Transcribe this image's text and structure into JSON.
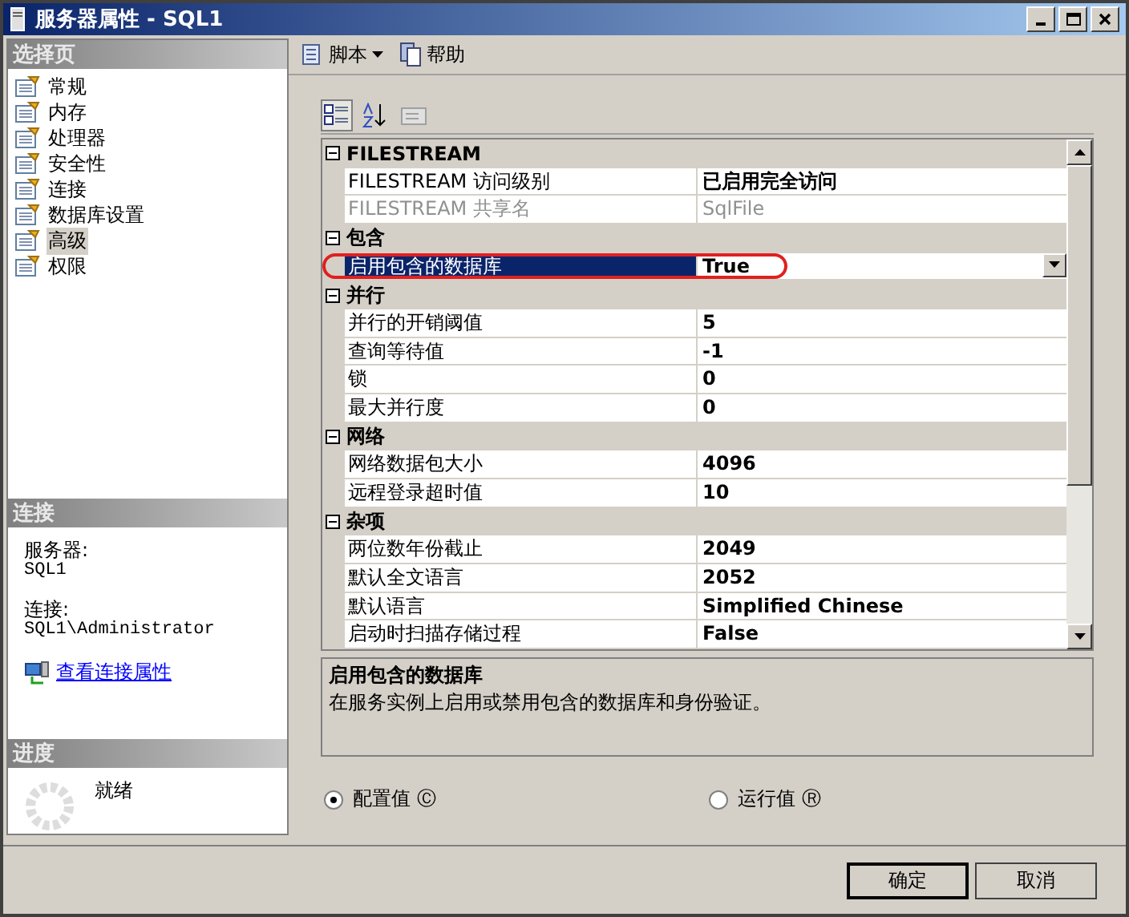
{
  "window": {
    "title": "服务器属性 - SQL1"
  },
  "select_page": {
    "header": "选择页",
    "items": [
      {
        "label": "常规",
        "selected": false
      },
      {
        "label": "内存",
        "selected": false
      },
      {
        "label": "处理器",
        "selected": false
      },
      {
        "label": "安全性",
        "selected": false
      },
      {
        "label": "连接",
        "selected": false
      },
      {
        "label": "数据库设置",
        "selected": false
      },
      {
        "label": "高级",
        "selected": true
      },
      {
        "label": "权限",
        "selected": false
      }
    ]
  },
  "connection": {
    "header": "连接",
    "server_label": "服务器:",
    "server": "SQL1",
    "connection_label": "连接:",
    "connection": "SQL1\\Administrator",
    "link": "查看连接属性"
  },
  "progress": {
    "header": "进度",
    "status": "就绪"
  },
  "toolbar": {
    "script": "脚本",
    "help": "帮助"
  },
  "properties": [
    {
      "category": "FILESTREAM",
      "expanded": true,
      "rows": [
        {
          "name": "FILESTREAM 访问级别",
          "value": "已启用完全访问",
          "disabled": false,
          "selected": false
        },
        {
          "name": "FILESTREAM 共享名",
          "value": "SqlFile",
          "disabled": true,
          "selected": false
        }
      ]
    },
    {
      "category": "包含",
      "expanded": true,
      "rows": [
        {
          "name": "启用包含的数据库",
          "value": "True",
          "disabled": false,
          "selected": true
        }
      ]
    },
    {
      "category": "并行",
      "expanded": true,
      "rows": [
        {
          "name": "并行的开销阈值",
          "value": "5",
          "disabled": false,
          "selected": false
        },
        {
          "name": "查询等待值",
          "value": "-1",
          "disabled": false,
          "selected": false
        },
        {
          "name": "锁",
          "value": "0",
          "disabled": false,
          "selected": false
        },
        {
          "name": "最大并行度",
          "value": "0",
          "disabled": false,
          "selected": false
        }
      ]
    },
    {
      "category": "网络",
      "expanded": true,
      "rows": [
        {
          "name": "网络数据包大小",
          "value": "4096",
          "disabled": false,
          "selected": false
        },
        {
          "name": "远程登录超时值",
          "value": "10",
          "disabled": false,
          "selected": false
        }
      ]
    },
    {
      "category": "杂项",
      "expanded": true,
      "rows": [
        {
          "name": "两位数年份截止",
          "value": "2049",
          "disabled": false,
          "selected": false
        },
        {
          "name": "默认全文语言",
          "value": "2052",
          "disabled": false,
          "selected": false
        },
        {
          "name": "默认语言",
          "value": "Simplified Chinese",
          "disabled": false,
          "selected": false
        },
        {
          "name": "启动时扫描存储过程",
          "value": "False",
          "disabled": false,
          "selected": false
        }
      ]
    }
  ],
  "description": {
    "title": "启用包含的数据库",
    "text": "在服务实例上启用或禁用包含的数据库和身份验证。"
  },
  "value_mode": [
    {
      "label": "配置值 Ⓒ",
      "selected": true
    },
    {
      "label": "运行值 Ⓡ",
      "selected": false
    }
  ],
  "buttons": [
    "确定",
    "取消"
  ]
}
